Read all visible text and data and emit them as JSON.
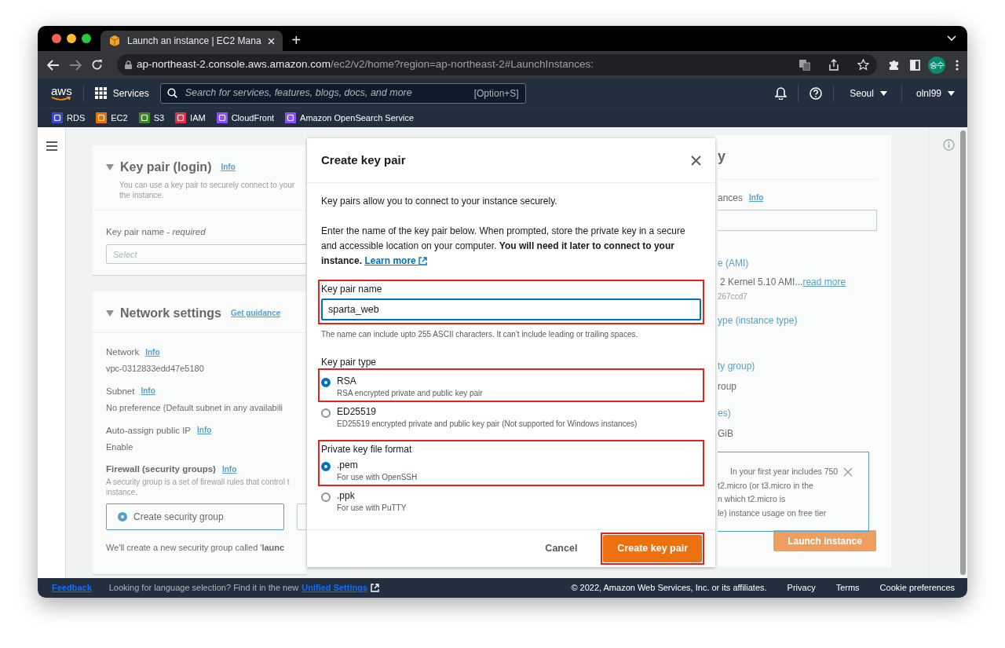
{
  "browser": {
    "tab_title": "Launch an instance | EC2 Mana",
    "new_tab": "+",
    "url_host": "ap-northeast-2.console.aws.amazon.com",
    "url_path": "/ec2/v2/home?region=ap-northeast-2#LaunchInstances:",
    "profile_initials": "승수"
  },
  "console_nav": {
    "logo": "aws",
    "services": "Services",
    "search_placeholder": "Search for services, features, blogs, docs, and more",
    "search_shortcut": "[Option+S]",
    "region": "Seoul",
    "account": "olnl99"
  },
  "favorites": [
    {
      "label": "RDS",
      "color": "#3b48cc"
    },
    {
      "label": "EC2",
      "color": "#ed7100"
    },
    {
      "label": "S3",
      "color": "#3f8624"
    },
    {
      "label": "IAM",
      "color": "#dd344c"
    },
    {
      "label": "CloudFront",
      "color": "#8c4fff"
    },
    {
      "label": "Amazon OpenSearch Service",
      "color": "#8c4fff"
    }
  ],
  "background_page": {
    "key_pair_section": {
      "title": "Key pair (login)",
      "info": "Info",
      "description_lines": [
        "You can use a key pair to securely connect to your",
        "the instance."
      ],
      "field_label": "Key pair name - *required*",
      "select_placeholder": "Select"
    },
    "network_section": {
      "title": "Network settings",
      "guidance": "Get guidance",
      "fields": [
        {
          "label": "Network",
          "info": "Info",
          "value": "vpc-0312833edd47e5180"
        },
        {
          "label": "Subnet",
          "info": "Info",
          "value": "No preference (Default subnet in any availabili"
        },
        {
          "label": "Auto-assign public IP",
          "info": "Info",
          "value": "Enable"
        }
      ],
      "firewall": {
        "label": "Firewall (security groups)",
        "info": "Info",
        "description_lines": [
          "A security group is a set of firewall rules that control t",
          "instance."
        ],
        "option": {
          "label": "Create security group",
          "selected": true
        },
        "note": "We'll create a new security group called '**launc**"
      }
    },
    "summary_panel": {
      "title": "y",
      "instances_label": "ances",
      "instances_info": "Info",
      "ami_label": "e (AMI)",
      "ami_value": "2 Kernel 5.10 AMI...",
      "ami_link": "read more",
      "ami_id": "267ccd7",
      "instance_type_label": "ype (instance type)",
      "firewall_label": "ty group)",
      "firewall_value": "roup",
      "storage_label": "es)",
      "storage_value": "GiB",
      "free_tier_lines": [
        "In your first year includes 750",
        "t2.micro (or t3.micro in the",
        "n which t2.micro is",
        "le) instance usage on free tier"
      ],
      "launch_button": "Launch instance"
    }
  },
  "modal": {
    "title": "Create key pair",
    "intro": "Key pairs allow you to connect to your instance securely.",
    "instructions": "Enter the name of the key pair below. When prompted, store the private key in a secure and accessible location on your computer. **You will need it later to connect to your instance.**",
    "learn_more": "Learn more",
    "name_field": {
      "label": "Key pair name",
      "value": "sparta_web",
      "hint": "The name can include upto 255 ASCII characters. It can't include leading or trailing spaces.",
      "focused": true,
      "highlighted": true
    },
    "key_pair_type": {
      "label": "Key pair type",
      "highlighted": false,
      "options": [
        {
          "label": "RSA",
          "description": "RSA encrypted private and public key pair",
          "selected": true,
          "highlighted": true
        },
        {
          "label": "ED25519",
          "description": "ED25519 encrypted private and public key pair (Not supported for Windows instances)",
          "selected": false,
          "highlighted": false
        }
      ]
    },
    "file_format": {
      "label": "Private key file format",
      "highlighted": true,
      "options": [
        {
          "label": ".pem",
          "description": "For use with OpenSSH",
          "selected": true,
          "highlighted": true
        },
        {
          "label": ".ppk",
          "description": "For use with PuTTY",
          "selected": false,
          "highlighted": false
        }
      ]
    },
    "cancel_button": "Cancel",
    "create_button": {
      "label": "Create key pair",
      "highlighted": true
    }
  },
  "footer": {
    "feedback": "Feedback",
    "language_notice": "Looking for language selection? Find it in the new",
    "unified_settings": "Unified Settings",
    "copyright": "© 2022, Amazon Web Services, Inc. or its affiliates.",
    "links": [
      "Privacy",
      "Terms",
      "Cookie preferences"
    ]
  }
}
